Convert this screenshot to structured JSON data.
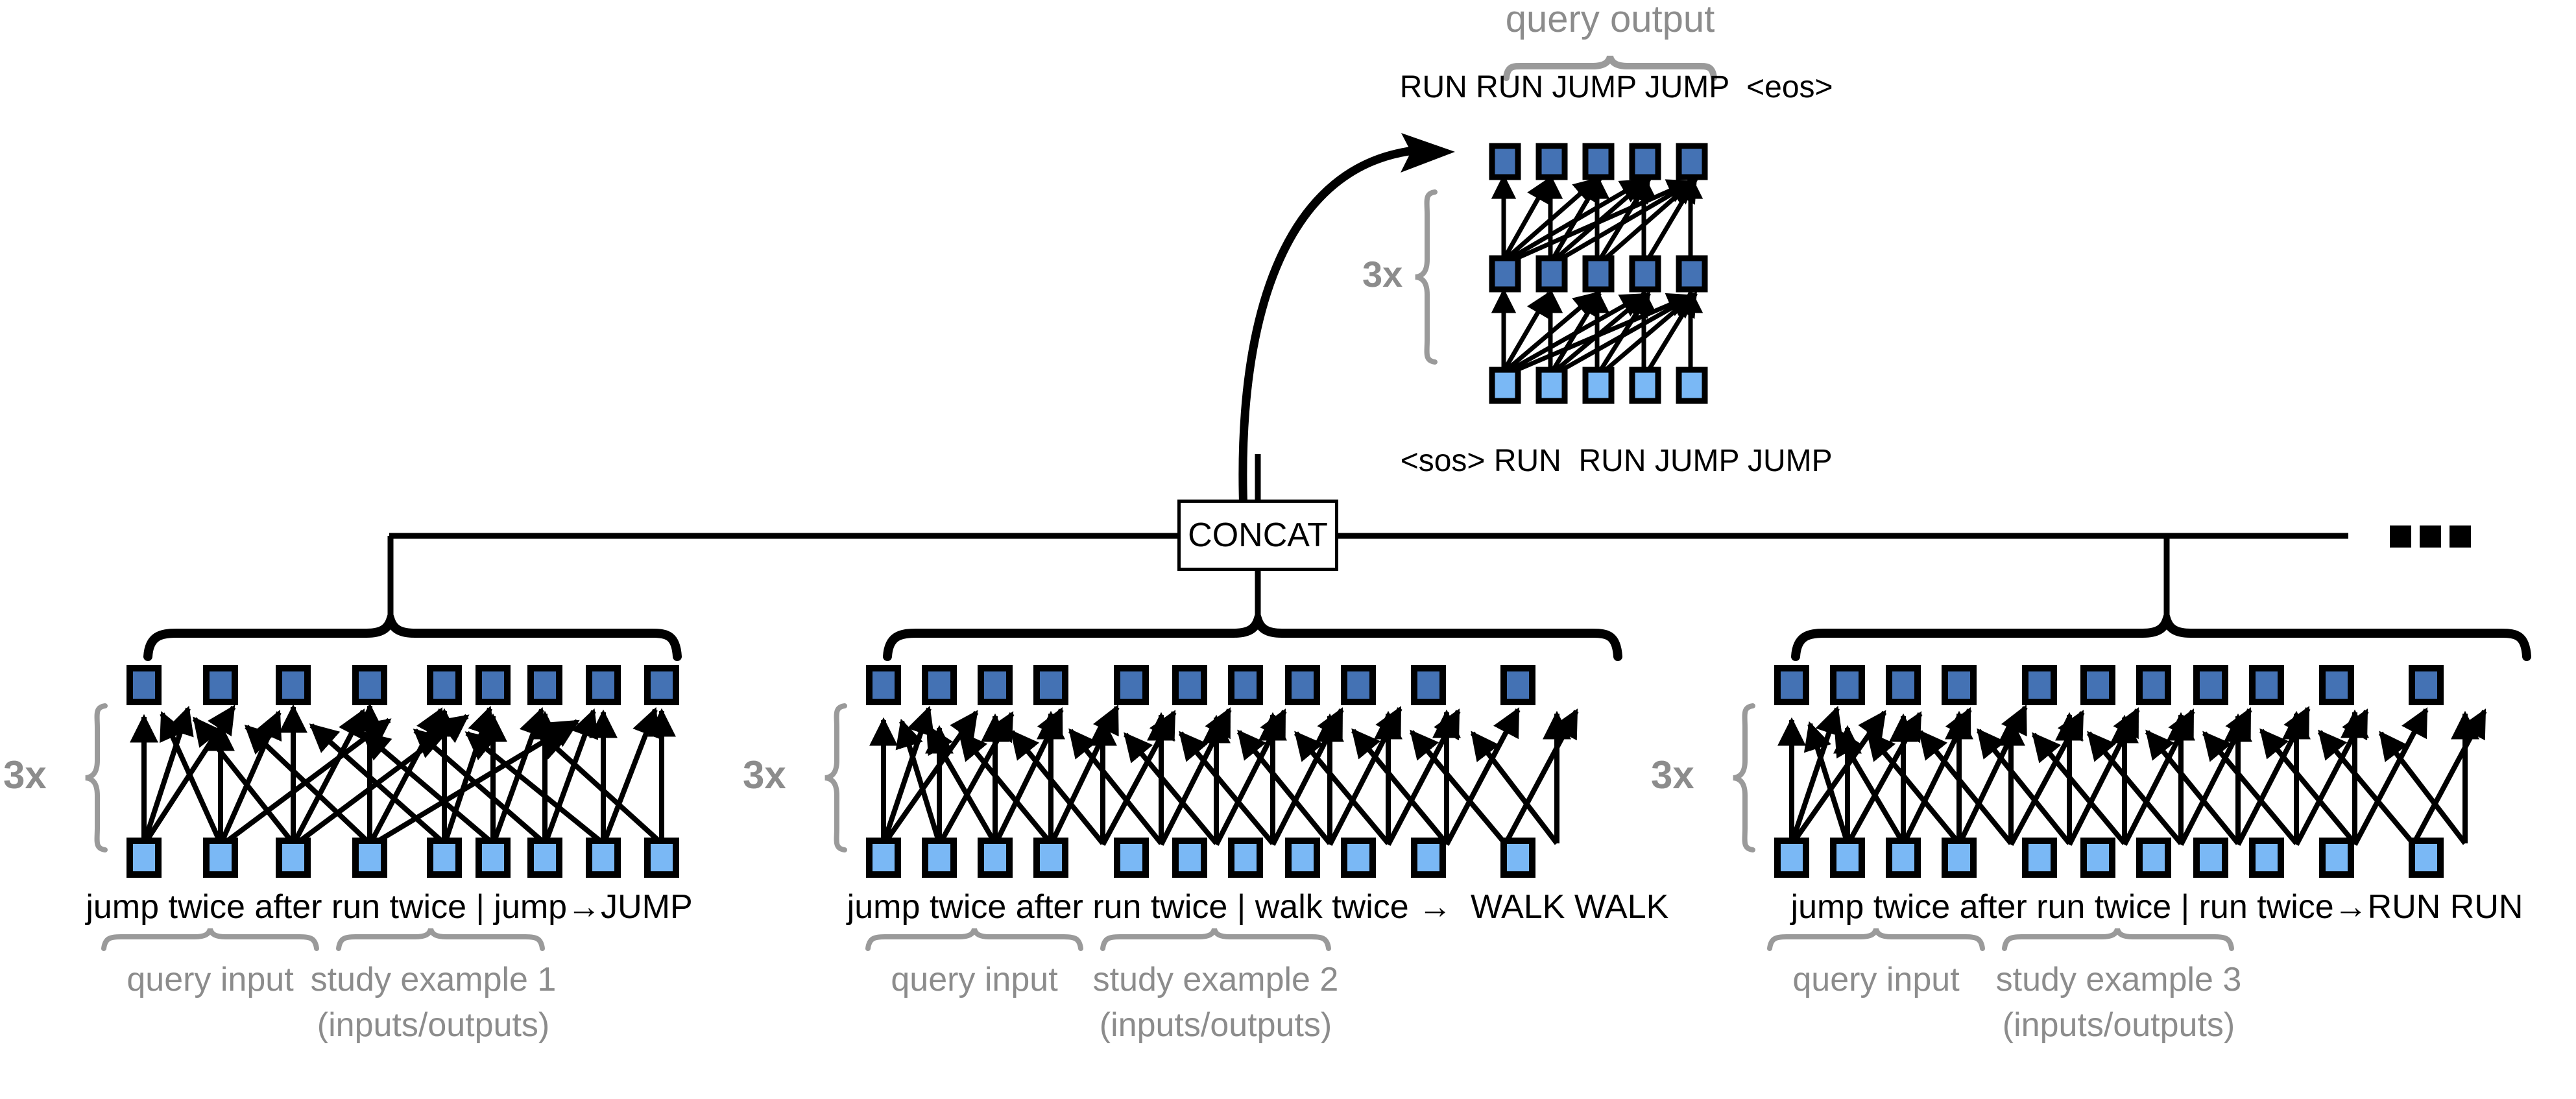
{
  "figure": {
    "type": "neural-network-architecture-diagram",
    "description": "Meta-learning sequence-to-sequence transformer architecture with multiple encoders feeding a CONCAT node and one decoder producing the query output"
  },
  "colors": {
    "node_dark_blue": "#4472b4",
    "node_light_blue": "#7ab8f5",
    "node_border": "#000000",
    "gray_label": "#8c8c8c",
    "line": "#000000",
    "background": "#ffffff"
  },
  "decoder": {
    "query_output_label": "query output",
    "repeat_label": "3x",
    "output_tokens": [
      "RUN",
      "RUN",
      "JUMP",
      "JUMP",
      "<eos>"
    ],
    "input_tokens": [
      "<sos>",
      "RUN",
      "RUN",
      "JUMP",
      "JUMP"
    ],
    "rows": 3,
    "columns": 5,
    "row_colors": [
      "dark",
      "dark",
      "light"
    ]
  },
  "concat": {
    "label": "CONCAT",
    "ellipsis": "• • •"
  },
  "encoders": [
    {
      "index": 1,
      "repeat_label": "3x",
      "token_text": "jump twice after run twice | jump→JUMP",
      "query_label": "query input",
      "study_label_line1": "study example 1",
      "study_label_line2": "(inputs/outputs)",
      "node_count": 9,
      "rows": 2,
      "row_colors": [
        "dark",
        "light"
      ]
    },
    {
      "index": 2,
      "repeat_label": "3x",
      "token_text": "jump twice after run twice | walk twice →  WALK WALK",
      "query_label": "query input",
      "study_label_line1": "study example 2",
      "study_label_line2": "(inputs/outputs)",
      "node_count": 11,
      "rows": 2,
      "row_colors": [
        "dark",
        "light"
      ]
    },
    {
      "index": 3,
      "repeat_label": "3x",
      "token_text": "jump twice after run twice | run twice→RUN RUN",
      "query_label": "query input",
      "study_label_line1": "study example 3",
      "study_label_line2": "(inputs/outputs)",
      "node_count": 11,
      "rows": 2,
      "row_colors": [
        "dark",
        "light"
      ]
    }
  ]
}
